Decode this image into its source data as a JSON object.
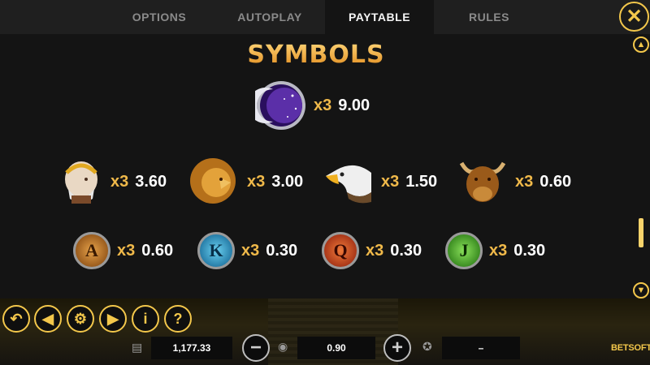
{
  "tabs": [
    {
      "label": "OPTIONS",
      "active": false
    },
    {
      "label": "AUTOPLAY",
      "active": false
    },
    {
      "label": "PAYTABLE",
      "active": true
    },
    {
      "label": "RULES",
      "active": false
    }
  ],
  "close_icon": "close-icon",
  "section_title": "SYMBOLS",
  "symbols": {
    "moon": {
      "icon": "moon-symbol",
      "mult": "x3",
      "pay": "9.00"
    },
    "king": {
      "icon": "laurel-king-symbol",
      "mult": "x3",
      "pay": "3.60"
    },
    "lion": {
      "icon": "lion-symbol",
      "mult": "x3",
      "pay": "3.00"
    },
    "eagle": {
      "icon": "eagle-symbol",
      "mult": "x3",
      "pay": "1.50"
    },
    "bull": {
      "icon": "bull-symbol",
      "mult": "x3",
      "pay": "0.60"
    },
    "a": {
      "letter": "A",
      "mult": "x3",
      "pay": "0.60",
      "color": "#c27a2a"
    },
    "k": {
      "letter": "K",
      "mult": "x3",
      "pay": "0.30",
      "color": "#2a8fc2"
    },
    "q": {
      "letter": "Q",
      "mult": "x3",
      "pay": "0.30",
      "color": "#c2372a"
    },
    "j": {
      "letter": "J",
      "mult": "x3",
      "pay": "0.30",
      "color": "#3a9a2a"
    }
  },
  "scroll": {
    "up_icon": "chevron-up-icon",
    "down_icon": "chevron-down-icon",
    "position": 0.85
  },
  "controls": [
    "back-icon",
    "previous-icon",
    "settings-icon",
    "next-icon",
    "info-icon",
    "help-icon"
  ],
  "help_label": "?",
  "info_label": "i",
  "balance": "1,177.33",
  "bet": "0.90",
  "win": "–",
  "brand": "BETSOFT",
  "colors": {
    "accent": "#f3c74b",
    "multiplier": "#f0b94a"
  }
}
